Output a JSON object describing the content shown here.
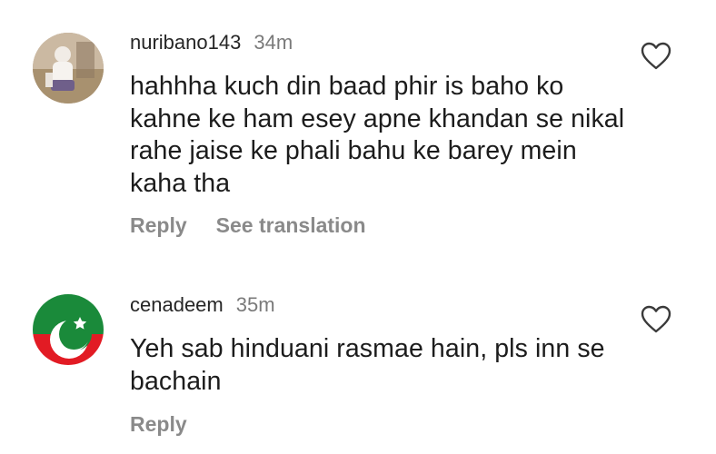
{
  "comments": [
    {
      "username": "nuribano143",
      "time": "34m",
      "text": "hahhha kuch din baad phir is baho ko kahne ke ham esey apne khandan se nikal rahe jaise ke phali bahu ke barey mein kaha tha",
      "reply_label": "Reply",
      "translate_label": "See translation",
      "avatar_icon": "user-photo-avatar",
      "like_icon": "heart-outline-icon"
    },
    {
      "username": "cenadeem",
      "time": "35m",
      "text": "Yeh sab hinduani rasmae hain, pls inn se bachain",
      "reply_label": "Reply",
      "avatar_icon": "pti-flag-avatar",
      "like_icon": "heart-outline-icon"
    }
  ],
  "colors": {
    "flag_green": "#1a8a3a",
    "flag_red": "#e21b24",
    "muted_text": "#8a8a8a"
  }
}
